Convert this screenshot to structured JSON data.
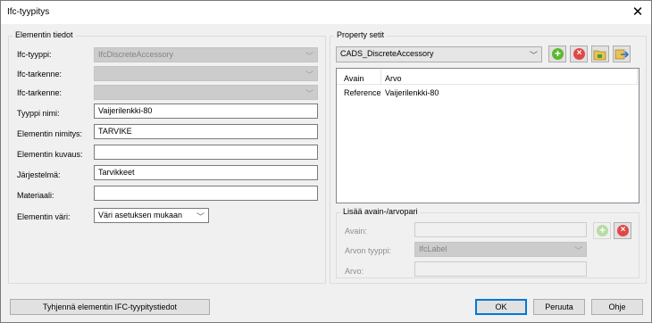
{
  "window": {
    "title": "Ifc-tyypitys"
  },
  "element_group": {
    "title": "Elementin tiedot",
    "fields": {
      "ifc_type": {
        "label": "Ifc-tyyppi:",
        "value": "IfcDiscreteAccessory"
      },
      "ifc_detail1": {
        "label": "Ifc-tarkenne:",
        "value": ""
      },
      "ifc_detail2": {
        "label": "Ifc-tarkenne:",
        "value": ""
      },
      "type_name": {
        "label": "Tyyppi nimi:",
        "value": "Vaijerilenkki-80"
      },
      "element_name": {
        "label": "Elementin nimitys:",
        "value": "TARVIKE"
      },
      "element_desc": {
        "label": "Elementin kuvaus:",
        "value": ""
      },
      "system": {
        "label": "Järjestelmä:",
        "value": "Tarvikkeet"
      },
      "material": {
        "label": "Materiaali:",
        "value": ""
      },
      "color": {
        "label": "Elementin väri:",
        "value": "Väri asetuksen mukaan"
      }
    }
  },
  "property_group": {
    "title": "Property setit",
    "selected_set": "CADS_DiscreteAccessory",
    "icons": [
      "add-icon",
      "remove-icon",
      "folder-icon",
      "export-icon"
    ],
    "columns": [
      "Avain",
      "Arvo"
    ],
    "rows": [
      {
        "key": "Reference",
        "value": "Vaijerilenkki-80"
      }
    ]
  },
  "pair_group": {
    "title": "Lisää avain-/arvopari",
    "key_label": "Avain:",
    "type_label": "Arvon tyyppi:",
    "type_value": "IfcLabel",
    "value_label": "Arvo:"
  },
  "buttons": {
    "clear": "Tyhjennä elementin IFC-tyypitystiedot",
    "ok": "OK",
    "cancel": "Peruuta",
    "help": "Ohje"
  },
  "colors": {
    "add": "#5cb82e",
    "remove": "#e04848",
    "accent": "#0078d7"
  }
}
